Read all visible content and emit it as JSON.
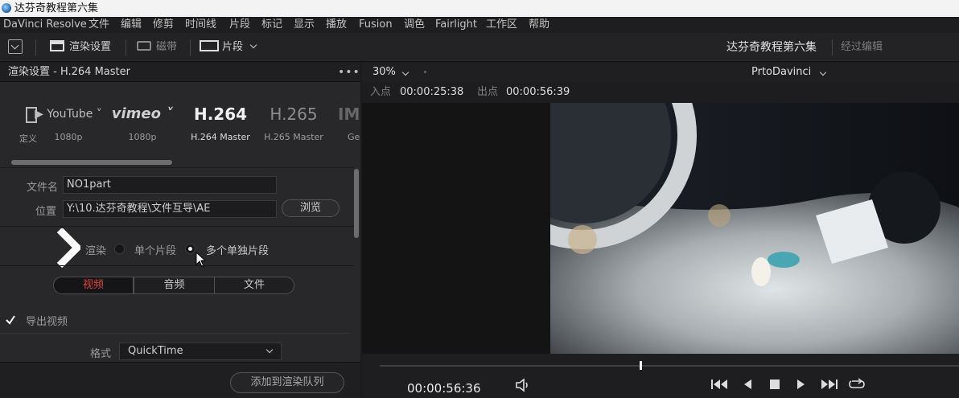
{
  "window": {
    "title": "达芬奇教程第六集"
  },
  "menu": [
    "DaVinci Resolve",
    "文件",
    "编辑",
    "修剪",
    "时间线",
    "片段",
    "标记",
    "显示",
    "播放",
    "Fusion",
    "调色",
    "Fairlight",
    "工作区",
    "帮助"
  ],
  "toolbar": {
    "render_settings": "渲染设置",
    "tape": "磁带",
    "clips": "片段",
    "project_name": "达芬奇教程第六集",
    "edited_status": "经过编辑"
  },
  "render_panel": {
    "title": "渲染设置 - H.264 Master",
    "presets": [
      {
        "name": "定义",
        "label": "定义"
      },
      {
        "name": "YouTube",
        "label": "1080p"
      },
      {
        "name": "vimeo",
        "label": "1080p"
      },
      {
        "name": "H.264",
        "label": "H.264 Master"
      },
      {
        "name": "H.265",
        "label": "H.265 Master"
      },
      {
        "name": "IM",
        "label": "Ger"
      }
    ],
    "filename_label": "文件名",
    "filename": "NO1part",
    "location_label": "位置",
    "location": "Y:\\10.达芬奇教程\\文件互导\\AE",
    "browse": "浏览",
    "render_label": "渲染",
    "single_clip": "单个片段",
    "multiple_clips": "多个单独片段",
    "tabs": [
      "视频",
      "音频",
      "文件"
    ],
    "export_video": "导出视频",
    "format_label": "格式",
    "format": "QuickTime",
    "add_to_queue": "添加到渲染队列"
  },
  "viewer": {
    "zoom": "30%",
    "source": "PrtoDavinci",
    "in_label": "入点",
    "in_tc": "00:00:25:38",
    "out_label": "出点",
    "out_tc": "00:00:56:39",
    "current_tc": "00:00:56:36",
    "playhead_fraction": 0.45
  },
  "colors": {
    "accent_red": "#e0443a",
    "bg": "#1b1b1d"
  }
}
